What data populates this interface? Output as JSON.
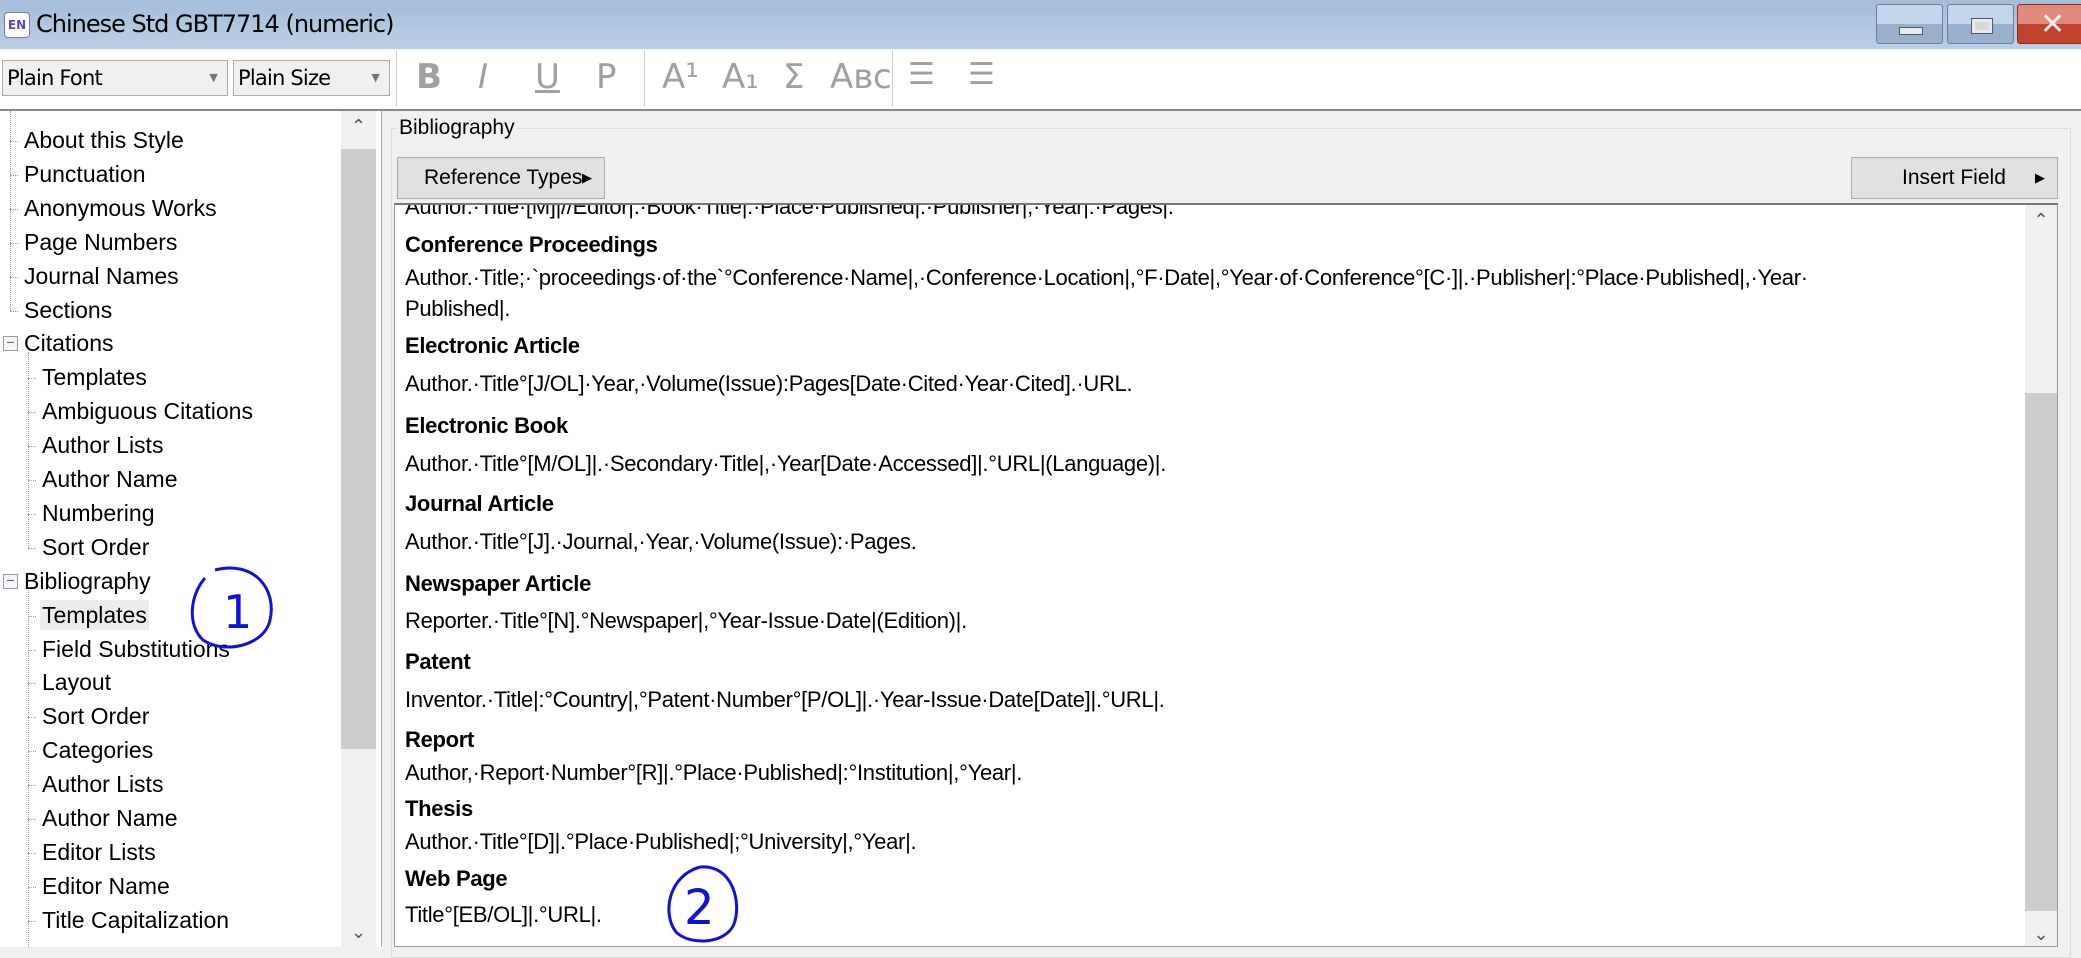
{
  "window": {
    "app_icon": "EN",
    "title": "Chinese Std GBT7714 (numeric)",
    "minimize_icon": "minimize-icon",
    "maximize_icon": "maximize-icon",
    "close_icon": "close-icon"
  },
  "toolbar": {
    "font": "Plain Font",
    "size": "Plain Size",
    "bold": "B",
    "italic": "I",
    "underline": "U",
    "plain": "P",
    "superscript": "A¹",
    "subscript": "A₁",
    "symbol": "Σ",
    "small_caps": "Aʙᴄ",
    "align_left_icon": "align-left-icon",
    "justify_icon": "justify-icon"
  },
  "tree": [
    {
      "label": "About this Style",
      "level": 1
    },
    {
      "label": "Punctuation",
      "level": 1
    },
    {
      "label": "Anonymous Works",
      "level": 1
    },
    {
      "label": "Page Numbers",
      "level": 1
    },
    {
      "label": "Journal Names",
      "level": 1
    },
    {
      "label": "Sections",
      "level": 1
    },
    {
      "label": "Citations",
      "level": 0,
      "expanded": true
    },
    {
      "label": "Templates",
      "level": 2
    },
    {
      "label": "Ambiguous Citations",
      "level": 2
    },
    {
      "label": "Author Lists",
      "level": 2
    },
    {
      "label": "Author Name",
      "level": 2
    },
    {
      "label": "Numbering",
      "level": 2
    },
    {
      "label": "Sort Order",
      "level": 2
    },
    {
      "label": "Bibliography",
      "level": 0,
      "expanded": true
    },
    {
      "label": "Templates",
      "level": 2,
      "selected": true
    },
    {
      "label": "Field Substitutions",
      "level": 2
    },
    {
      "label": "Layout",
      "level": 2
    },
    {
      "label": "Sort Order",
      "level": 2
    },
    {
      "label": "Categories",
      "level": 2
    },
    {
      "label": "Author Lists",
      "level": 2
    },
    {
      "label": "Author Name",
      "level": 2
    },
    {
      "label": "Editor Lists",
      "level": 2
    },
    {
      "label": "Editor Name",
      "level": 2
    },
    {
      "label": "Title Capitalization",
      "level": 2
    }
  ],
  "panel": {
    "group_label": "Bibliography",
    "reference_types": "Reference Types",
    "insert_field": "Insert Field"
  },
  "templates": [
    {
      "text": "Author.·Title·[M]|//Editor|.·Book·Title|.·Place·Published|:·Publisher|,·Year|:·Pages|.",
      "bold": false,
      "clipped": true
    },
    {
      "text": "Conference Proceedings",
      "bold": true
    },
    {
      "text": "Author.·Title;·`proceedings·of·the`°Conference·Name|,·Conference·Location|,°F·Date|,°Year·of·Conference°[C·]|.·Publisher|:°Place·Published|,·Year·",
      "bold": false
    },
    {
      "text": "Published|.",
      "bold": false
    },
    {
      "text": "Electronic Article",
      "bold": true
    },
    {
      "text": "Author.·Title°[J/OL]·Year,·Volume(Issue):Pages[Date·Cited·Year·Cited].·URL.",
      "bold": false
    },
    {
      "text": "Electronic Book",
      "bold": true
    },
    {
      "text": "Author.·Title°[M/OL]|.·Secondary·Title|,·Year[Date·Accessed]|.°URL|(Language)|.",
      "bold": false
    },
    {
      "text": "Journal Article",
      "bold": true
    },
    {
      "text": "Author.·Title°[J].·Journal,·Year,·Volume(Issue):·Pages.",
      "bold": false
    },
    {
      "text": "Newspaper Article",
      "bold": true
    },
    {
      "text": "Reporter.·Title°[N].°Newspaper|,°Year-Issue·Date|(Edition)|.",
      "bold": false
    },
    {
      "text": "Patent",
      "bold": true
    },
    {
      "text": "Inventor.·Title|:°Country|,°Patent·Number°[P/OL]|.·Year-Issue·Date[Date]|.°URL|.",
      "bold": false
    },
    {
      "text": "Report",
      "bold": true
    },
    {
      "text": "Author,·Report·Number°[R]|.°Place·Published|:°Institution|,°Year|.",
      "bold": false
    },
    {
      "text": "Thesis",
      "bold": true
    },
    {
      "text": "Author.·Title°[D]|.°Place·Published|;°University|,°Year|.",
      "bold": false
    },
    {
      "text": "Web Page",
      "bold": true
    },
    {
      "text": "Title°[EB/OL]|.°URL|.",
      "bold": false
    }
  ],
  "annotations": [
    {
      "label": "1",
      "color": "#1010e0"
    },
    {
      "label": "2",
      "color": "#1010e0"
    }
  ]
}
